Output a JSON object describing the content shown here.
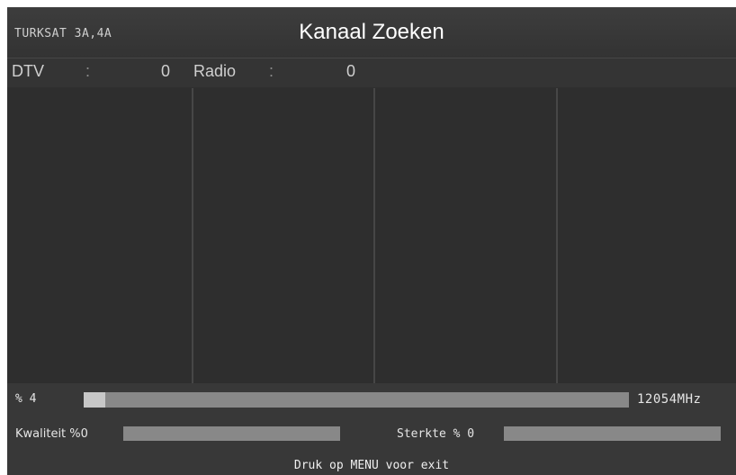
{
  "header": {
    "satellite": "TURKSAT 3A,4A",
    "title": "Kanaal Zoeken"
  },
  "counts": {
    "dtv_label": "DTV",
    "dtv_colon": ":",
    "dtv_value": "0",
    "radio_label": "Radio",
    "radio_colon": ":",
    "radio_value": "0"
  },
  "progress": {
    "label": "% 4",
    "percent": 4,
    "frequency": "12054MHz"
  },
  "signal": {
    "quality_label": "Kwaliteit %0",
    "quality_percent": 0,
    "strength_label": "Sterkte % 0",
    "strength_percent": 0
  },
  "footer": {
    "hint": "Druk op MENU voor exit"
  },
  "colors": {
    "background": "#2f2f2f",
    "bar_track": "#888888",
    "bar_fill": "#c7c7c7",
    "text": "#e6e6e6"
  }
}
